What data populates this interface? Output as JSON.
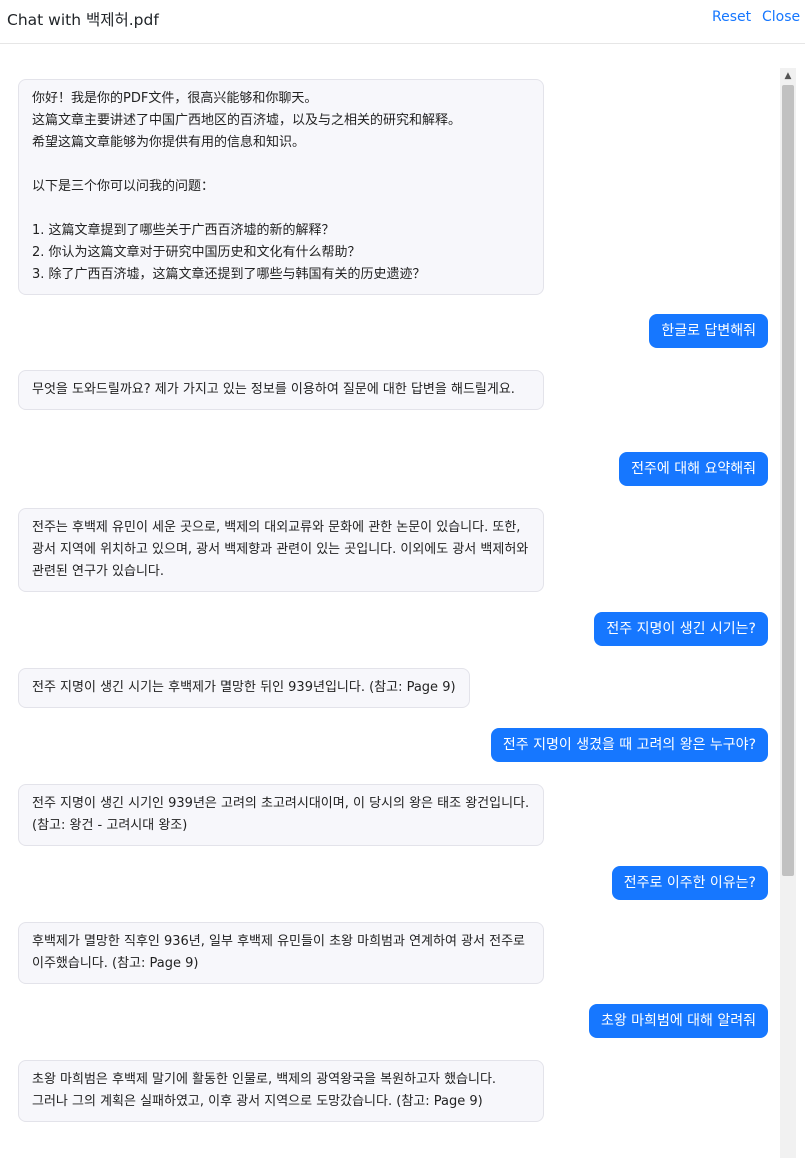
{
  "header": {
    "title": "Chat with 백제허.pdf",
    "reset_label": "Reset",
    "close_label": "Close"
  },
  "messages": [
    {
      "role": "bot",
      "text": "你好！我是你的PDF文件，很高兴能够和你聊天。这篇文章主要讲述了中国广西地区的百济墟，以及与之相关的研究和解释。希望这篇文章能够为你提供有用的信息和知识。\n\n以下是三个你可以问我的问题：\n\n1. 这篇文章提到了哪些关于广西百济墟的新的解释？\n2. 你认为这篇文章对于研究中国历史和文化有什么帮助？\n3. 除了广西百济墟，这篇文章还提到了哪些与韩国有关的历史遗迹？"
    },
    {
      "role": "user",
      "text": "한글로 답변해줘"
    },
    {
      "role": "bot",
      "text": "무엇을 도와드릴까요? 제가 가지고 있는 정보를 이용하여 질문에 대한 답변을 해드릴게요."
    },
    {
      "role": "user",
      "text": "전주에 대해 요약해줘"
    },
    {
      "role": "bot",
      "text": "전주는 후백제 유민이 세운 곳으로, 백제의 대외교류와 문화에 관한 논문이 있습니다. 또한, 광서 지역에 위치하고 있으며, 광서 백제향과 관련이 있는 곳입니다. 이외에도 광서 백제허와 관련된 연구가 있습니다."
    },
    {
      "role": "user",
      "text": "전주 지명이 생긴 시기는?"
    },
    {
      "role": "bot",
      "text": "전주 지명이 생긴 시기는 후백제가 멸망한 뒤인 939년입니다. (참고: Page 9)"
    },
    {
      "role": "user",
      "text": "전주 지명이 생겼을 때 고려의 왕은 누구야?"
    },
    {
      "role": "bot",
      "text": "전주 지명이 생긴 시기인 939년은 고려의 초고려시대이며, 이 당시의 왕은 태조 왕건입니다. (참고: 왕건 - 고려시대 왕조)"
    },
    {
      "role": "user",
      "text": "전주로 이주한 이유는?"
    },
    {
      "role": "bot",
      "text": "후백제가 멸망한 직후인 936년, 일부 후백제 유민들이 초왕 마희범과 연계하여 광서 전주로 이주했습니다. (참고: Page 9)"
    },
    {
      "role": "user",
      "text": "초왕 마희범에 대해 알려줘"
    },
    {
      "role": "bot",
      "text": "초왕 마희범은 후백제 말기에 활동한 인물로, 백제의 광역왕국을 복원하고자 했습니다. 그러나 그의 계획은 실패하였고, 이후 광서 지역으로 도망갔습니다. (참고: Page 9)"
    }
  ],
  "scrollbar": {
    "up_icon": "▲"
  }
}
